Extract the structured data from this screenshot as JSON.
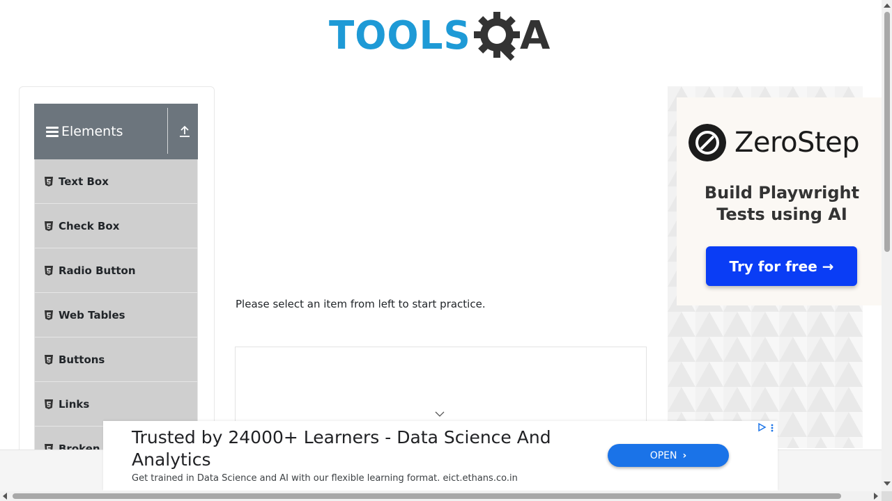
{
  "header": {
    "logo_text": "TOOLS",
    "logo_suffix": "A",
    "logo_icon": "gear-q-icon"
  },
  "sidebar": {
    "group_title": "Elements",
    "group_icon": "hamburger-icon",
    "collapse_icon": "upload-icon",
    "items": [
      {
        "label": "Text Box",
        "icon": "html5-icon"
      },
      {
        "label": "Check Box",
        "icon": "html5-icon"
      },
      {
        "label": "Radio Button",
        "icon": "html5-icon"
      },
      {
        "label": "Web Tables",
        "icon": "html5-icon"
      },
      {
        "label": "Buttons",
        "icon": "html5-icon"
      },
      {
        "label": "Links",
        "icon": "html5-icon"
      },
      {
        "label": "Broken Links - Images",
        "icon": "html5-icon"
      }
    ]
  },
  "main": {
    "instructions": "Please select an item from left to start practice."
  },
  "right_ad": {
    "brand": "ZeroStep",
    "tagline_line1": "Build Playwright",
    "tagline_line2": "Tests using AI",
    "cta": "Try for free →"
  },
  "banner_ad": {
    "headline": "Trusted by 24000+ Learners - Data Science And Analytics",
    "subtext": "Get trained in Data Science and AI with our flexible learning format. eict.ethans.co.in",
    "cta": "OPEN",
    "cta_chevron": "›"
  },
  "colors": {
    "accent": "#1e9ad6",
    "sidebar_header": "#6c757d",
    "menu_item": "#cfcfcf",
    "cta_blue": "#0a3df5",
    "open_blue": "#1a73e8"
  }
}
